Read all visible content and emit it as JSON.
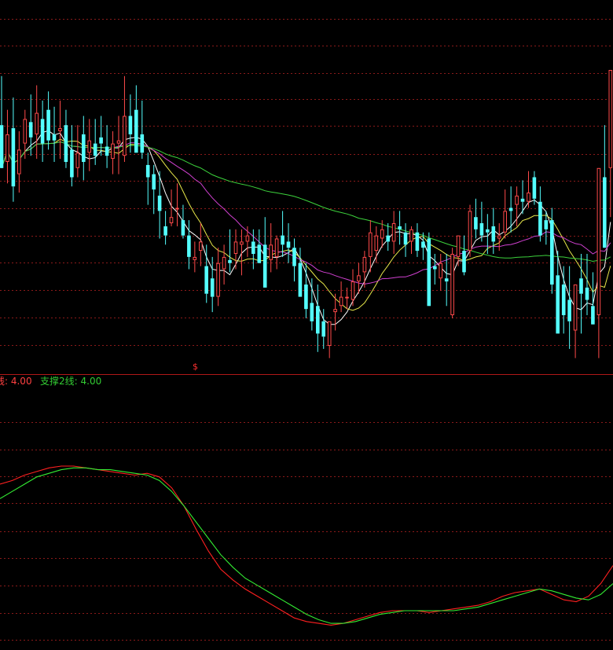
{
  "colors": {
    "background": "#000000",
    "grid": "#8b1a1a",
    "separator": "#b01818",
    "candle_up": "#ff4a4a",
    "candle_down": "#54ffff",
    "ma_short": "#ffffff",
    "ma_mid": "#e8e84a",
    "ma_long": "#d040d0",
    "ma_xlong": "#3cd23c",
    "osc_fast": "#ff2020",
    "osc_slow": "#33ee33"
  },
  "header": {
    "support1_text": "线: 4.00",
    "support2_text": "支撑2线: 4.00",
    "marker_text": "$"
  },
  "chart_data": [
    {
      "type": "candlestick",
      "title": "",
      "panel": "price",
      "note": "no price axis labels visible",
      "ylim": [
        0,
        100
      ],
      "candles": [
        {
          "o": 72,
          "h": 88,
          "l": 60,
          "c": 58
        },
        {
          "o": 60,
          "h": 77,
          "l": 53,
          "c": 69
        },
        {
          "o": 71,
          "h": 81,
          "l": 47,
          "c": 52
        },
        {
          "o": 56,
          "h": 70,
          "l": 50,
          "c": 64
        },
        {
          "o": 66,
          "h": 77,
          "l": 61,
          "c": 74
        },
        {
          "o": 73,
          "h": 82,
          "l": 62,
          "c": 68
        },
        {
          "o": 69,
          "h": 85,
          "l": 61,
          "c": 76
        },
        {
          "o": 74,
          "h": 80,
          "l": 60,
          "c": 66
        },
        {
          "o": 77,
          "h": 83,
          "l": 64,
          "c": 67
        },
        {
          "o": 69,
          "h": 78,
          "l": 60,
          "c": 67
        },
        {
          "o": 70,
          "h": 80,
          "l": 61,
          "c": 71
        },
        {
          "o": 72,
          "h": 77,
          "l": 58,
          "c": 60
        },
        {
          "o": 64,
          "h": 72,
          "l": 52,
          "c": 55
        },
        {
          "o": 58,
          "h": 72,
          "l": 55,
          "c": 63
        },
        {
          "o": 69,
          "h": 75,
          "l": 54,
          "c": 60
        },
        {
          "o": 63,
          "h": 74,
          "l": 57,
          "c": 67
        },
        {
          "o": 66,
          "h": 74,
          "l": 59,
          "c": 62
        },
        {
          "o": 68,
          "h": 75,
          "l": 62,
          "c": 66
        },
        {
          "o": 65,
          "h": 72,
          "l": 58,
          "c": 62
        },
        {
          "o": 61,
          "h": 70,
          "l": 56,
          "c": 66
        },
        {
          "o": 66,
          "h": 75,
          "l": 56,
          "c": 67
        },
        {
          "o": 62,
          "h": 88,
          "l": 60,
          "c": 75
        },
        {
          "o": 75,
          "h": 82,
          "l": 63,
          "c": 69
        },
        {
          "o": 77,
          "h": 85,
          "l": 63,
          "c": 63
        },
        {
          "o": 69,
          "h": 80,
          "l": 61,
          "c": 63
        },
        {
          "o": 59,
          "h": 63,
          "l": 46,
          "c": 55
        },
        {
          "o": 56,
          "h": 59,
          "l": 43,
          "c": 51
        },
        {
          "o": 49,
          "h": 57,
          "l": 35,
          "c": 44
        },
        {
          "o": 39,
          "h": 44,
          "l": 33,
          "c": 36
        },
        {
          "o": 40,
          "h": 51,
          "l": 39,
          "c": 42
        },
        {
          "o": 45,
          "h": 53,
          "l": 39,
          "c": 45
        },
        {
          "o": 41,
          "h": 46,
          "l": 35,
          "c": 36
        },
        {
          "o": 36,
          "h": 41,
          "l": 25,
          "c": 29
        },
        {
          "o": 28,
          "h": 34,
          "l": 24,
          "c": 29
        },
        {
          "o": 31,
          "h": 40,
          "l": 26,
          "c": 34
        },
        {
          "o": 26,
          "h": 33,
          "l": 14,
          "c": 17
        },
        {
          "o": 22,
          "h": 29,
          "l": 11,
          "c": 16
        },
        {
          "o": 16,
          "h": 32,
          "l": 13,
          "c": 27
        },
        {
          "o": 25,
          "h": 33,
          "l": 20,
          "c": 29
        },
        {
          "o": 28,
          "h": 38,
          "l": 24,
          "c": 27
        },
        {
          "o": 30,
          "h": 38,
          "l": 25,
          "c": 34
        },
        {
          "o": 33,
          "h": 38,
          "l": 23,
          "c": 34
        },
        {
          "o": 34,
          "h": 39,
          "l": 29,
          "c": 36
        },
        {
          "o": 34,
          "h": 38,
          "l": 25,
          "c": 30
        },
        {
          "o": 33,
          "h": 38,
          "l": 27,
          "c": 27
        },
        {
          "o": 33,
          "h": 42,
          "l": 19,
          "c": 19
        },
        {
          "o": 28,
          "h": 40,
          "l": 24,
          "c": 33
        },
        {
          "o": 29,
          "h": 36,
          "l": 25,
          "c": 35
        },
        {
          "o": 36,
          "h": 44,
          "l": 29,
          "c": 33
        },
        {
          "o": 34,
          "h": 40,
          "l": 27,
          "c": 32
        },
        {
          "o": 32,
          "h": 35,
          "l": 21,
          "c": 26
        },
        {
          "o": 27,
          "h": 32,
          "l": 16,
          "c": 16
        },
        {
          "o": 20,
          "h": 27,
          "l": 9,
          "c": 12
        },
        {
          "o": 14,
          "h": 22,
          "l": 5,
          "c": 8
        },
        {
          "o": 13,
          "h": 20,
          "l": -2,
          "c": 4
        },
        {
          "o": 8,
          "h": 12,
          "l": -1,
          "c": 3
        },
        {
          "o": 0,
          "h": 8,
          "l": -4,
          "c": 8
        },
        {
          "o": 11,
          "h": 17,
          "l": 5,
          "c": 12
        },
        {
          "o": 13,
          "h": 21,
          "l": 11,
          "c": 16
        },
        {
          "o": 16,
          "h": 19,
          "l": 12,
          "c": 16
        },
        {
          "o": 15,
          "h": 25,
          "l": 13,
          "c": 21
        },
        {
          "o": 21,
          "h": 27,
          "l": 17,
          "c": 23
        },
        {
          "o": 24,
          "h": 31,
          "l": 19,
          "c": 29
        },
        {
          "o": 29,
          "h": 41,
          "l": 24,
          "c": 37
        },
        {
          "o": 31,
          "h": 39,
          "l": 27,
          "c": 36
        },
        {
          "o": 35,
          "h": 41,
          "l": 32,
          "c": 38
        },
        {
          "o": 36,
          "h": 40,
          "l": 31,
          "c": 34
        },
        {
          "o": 34,
          "h": 44,
          "l": 30,
          "c": 40
        },
        {
          "o": 39,
          "h": 44,
          "l": 33,
          "c": 38
        },
        {
          "o": 37,
          "h": 40,
          "l": 29,
          "c": 33
        },
        {
          "o": 34,
          "h": 39,
          "l": 30,
          "c": 38
        },
        {
          "o": 37,
          "h": 40,
          "l": 29,
          "c": 31
        },
        {
          "o": 34,
          "h": 37,
          "l": 28,
          "c": 32
        },
        {
          "o": 35,
          "h": 37,
          "l": 13,
          "c": 13
        },
        {
          "o": 26,
          "h": 30,
          "l": 20,
          "c": 25
        },
        {
          "o": 22,
          "h": 30,
          "l": 18,
          "c": 27
        },
        {
          "o": 22,
          "h": 30,
          "l": 13,
          "c": 21
        },
        {
          "o": 10,
          "h": 32,
          "l": 9,
          "c": 30
        },
        {
          "o": 29,
          "h": 36,
          "l": 26,
          "c": 36
        },
        {
          "o": 31,
          "h": 36,
          "l": 23,
          "c": 24
        },
        {
          "o": 31,
          "h": 46,
          "l": 29,
          "c": 44
        },
        {
          "o": 42,
          "h": 48,
          "l": 35,
          "c": 38
        },
        {
          "o": 40,
          "h": 47,
          "l": 34,
          "c": 36
        },
        {
          "o": 38,
          "h": 43,
          "l": 30,
          "c": 37
        },
        {
          "o": 39,
          "h": 45,
          "l": 30,
          "c": 34
        },
        {
          "o": 35,
          "h": 40,
          "l": 31,
          "c": 36
        },
        {
          "o": 37,
          "h": 51,
          "l": 35,
          "c": 44
        },
        {
          "o": 45,
          "h": 52,
          "l": 37,
          "c": 44
        },
        {
          "o": 46,
          "h": 52,
          "l": 39,
          "c": 49
        },
        {
          "o": 48,
          "h": 54,
          "l": 43,
          "c": 47
        },
        {
          "o": 47,
          "h": 57,
          "l": 45,
          "c": 50
        },
        {
          "o": 55,
          "h": 57,
          "l": 46,
          "c": 48
        },
        {
          "o": 47,
          "h": 52,
          "l": 34,
          "c": 36
        },
        {
          "o": 41,
          "h": 44,
          "l": 33,
          "c": 38
        },
        {
          "o": 41,
          "h": 45,
          "l": 17,
          "c": 20
        },
        {
          "o": 23,
          "h": 31,
          "l": 4,
          "c": 4
        },
        {
          "o": 20,
          "h": 26,
          "l": 4,
          "c": 10
        },
        {
          "o": 15,
          "h": 26,
          "l": -1,
          "c": 8
        },
        {
          "o": 5,
          "h": 16,
          "l": -4,
          "c": 20
        },
        {
          "o": 22,
          "h": 30,
          "l": 4,
          "c": 17
        },
        {
          "o": 19,
          "h": 30,
          "l": 10,
          "c": 15
        },
        {
          "o": 13,
          "h": 24,
          "l": 10,
          "c": 7
        },
        {
          "o": 10,
          "h": 58,
          "l": -4,
          "c": 58
        },
        {
          "o": 55,
          "h": 72,
          "l": 38,
          "c": 32
        },
        {
          "o": 58,
          "h": 70,
          "l": 42,
          "c": 90
        }
      ],
      "moving_averages": [
        {
          "key": "ma_short",
          "period": 5
        },
        {
          "key": "ma_mid",
          "period": 10
        },
        {
          "key": "ma_long",
          "period": 20
        },
        {
          "key": "ma_xlong",
          "period": 60
        }
      ]
    },
    {
      "type": "line",
      "title": "",
      "panel": "oscillator",
      "ylim": [
        0,
        100
      ],
      "series": [
        {
          "color_key": "osc_fast",
          "values": [
            80,
            82,
            85,
            87,
            89,
            90,
            90,
            89,
            88,
            87,
            86,
            85,
            86,
            84,
            78,
            68,
            55,
            43,
            33,
            27,
            22,
            18,
            14,
            10,
            6,
            4,
            3,
            2,
            3,
            5,
            7,
            9,
            10,
            10,
            10,
            9,
            10,
            11,
            12,
            13,
            15,
            18,
            20,
            21,
            22,
            19,
            16,
            15,
            18,
            25,
            35
          ]
        },
        {
          "color_key": "osc_slow",
          "values": [
            72,
            76,
            80,
            84,
            86,
            88,
            89,
            89,
            88,
            88,
            87,
            86,
            85,
            82,
            76,
            68,
            59,
            50,
            41,
            34,
            28,
            24,
            20,
            16,
            12,
            8,
            5,
            3,
            3,
            4,
            6,
            8,
            9,
            10,
            10,
            10,
            10,
            10,
            11,
            12,
            14,
            16,
            18,
            20,
            22,
            21,
            19,
            17,
            16,
            19,
            25
          ]
        }
      ]
    }
  ]
}
